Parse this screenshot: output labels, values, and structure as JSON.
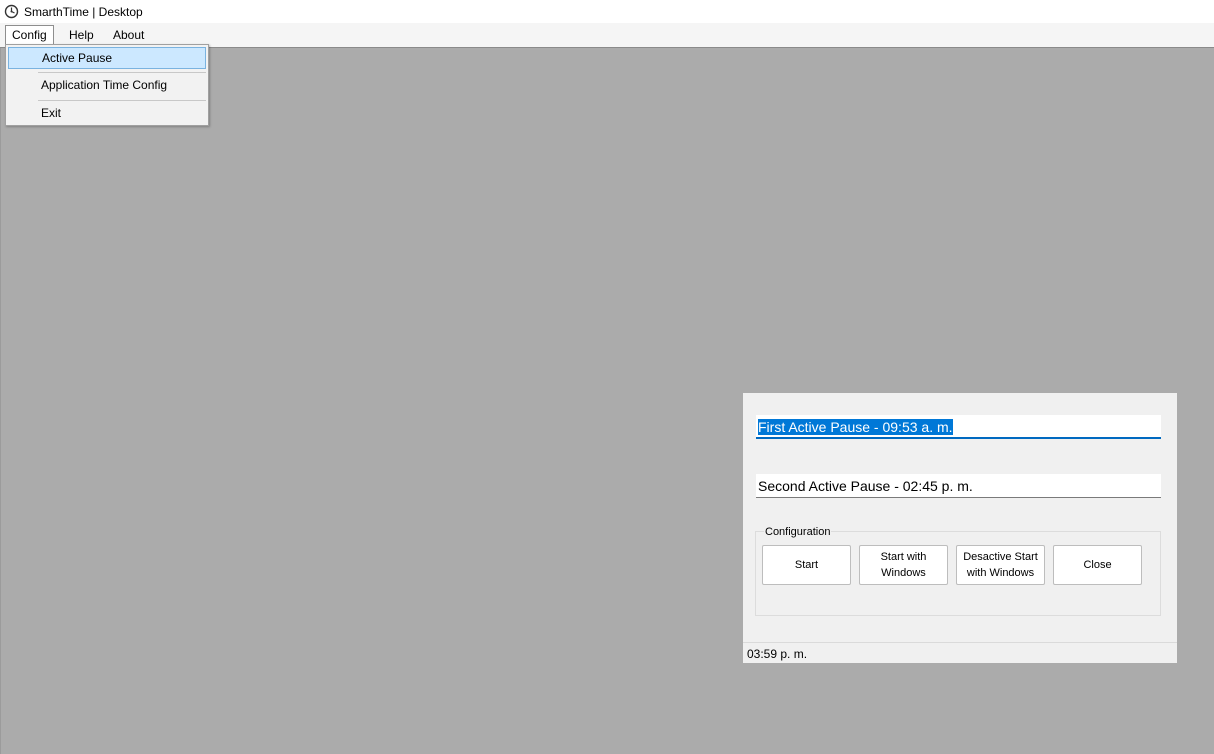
{
  "window": {
    "title": "SmarthTime | Desktop",
    "icon": "clock-gear-icon"
  },
  "menubar": {
    "items": [
      {
        "label": "Config"
      },
      {
        "label": "Help"
      },
      {
        "label": "About"
      }
    ]
  },
  "dropdown": {
    "items": [
      {
        "label": "Active Pause"
      },
      {
        "label": "Application Time Config"
      },
      {
        "label": "Exit"
      }
    ]
  },
  "panel": {
    "first_pause": "First Active Pause -  09:53 a. m.",
    "second_pause": "Second Active Pause - 02:45 p. m.",
    "group_label": "Configuration",
    "buttons": {
      "start": "Start",
      "start_with_windows": "Start with\nWindows",
      "desactive_start": "Desactive Start\nwith Windows",
      "close": "Close"
    },
    "status_time": "03:59 p. m."
  },
  "colors": {
    "background": "#ababab",
    "selection": "#0078d7",
    "menu_highlight": "#cce8ff"
  }
}
